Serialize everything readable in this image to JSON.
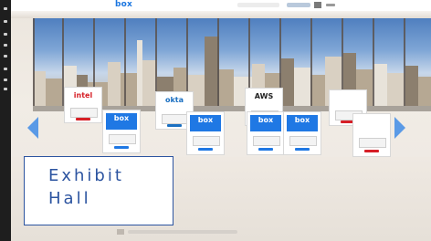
{
  "app": {
    "brand_logo": "box"
  },
  "topbar": {
    "search_icon": "search-field-icon",
    "user_icon": "user-name-icon",
    "avatar_icon": "avatar-icon",
    "more_icon": "more-icon"
  },
  "navigation": {
    "prev_icon": "triangle-left-icon",
    "next_icon": "triangle-right-icon"
  },
  "booths": [
    {
      "logo": "intel",
      "color": "#d61f26"
    },
    {
      "logo": "okta",
      "color": "#1a6fc1"
    },
    {
      "logo": "AWS",
      "color": "#222222"
    },
    {
      "logo": "box",
      "color": "#ffffff"
    },
    {
      "logo": "box",
      "color": "#ffffff"
    },
    {
      "logo": "box",
      "color": "#ffffff"
    },
    {
      "logo": "box",
      "color": "#ffffff"
    },
    {
      "logo": "",
      "color": "#222222"
    },
    {
      "logo": "",
      "color": "#c0272d"
    }
  ],
  "label": {
    "text": "Exhibit\nHall",
    "color": "#2c54a0"
  },
  "colors": {
    "accent": "#1f78e4",
    "rail": "#1e1e1e",
    "arrow": "#5a9ae6"
  }
}
